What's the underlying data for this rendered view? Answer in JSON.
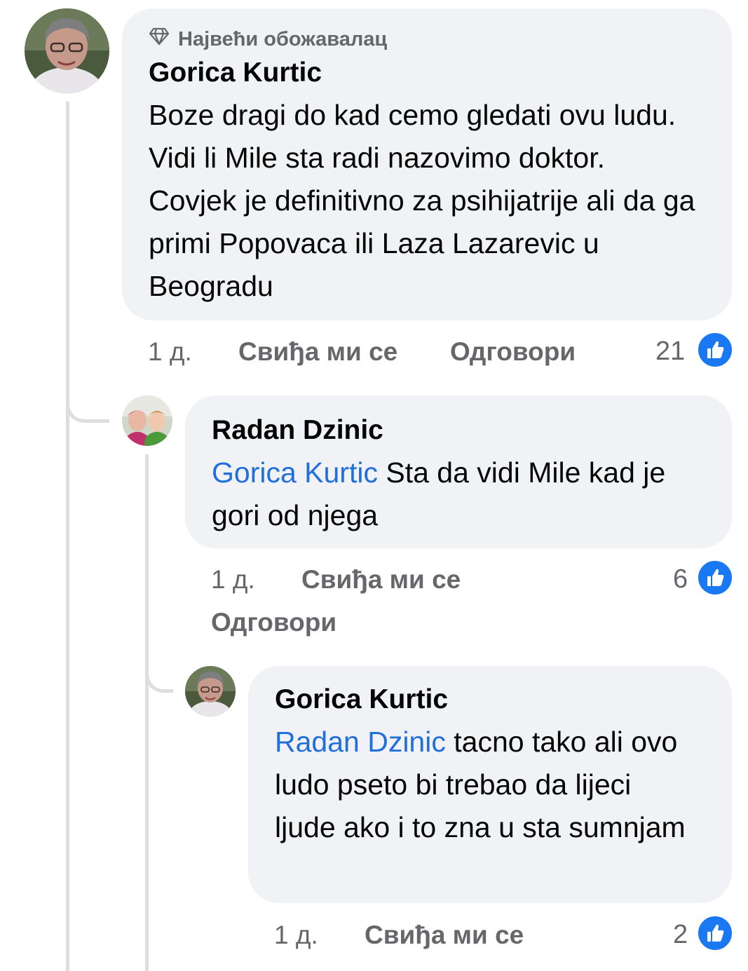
{
  "comments": [
    {
      "badge": "Највећи обожавалац",
      "author": "Gorica Kurtic",
      "text": "Boze dragi do kad cemo gledati ovu ludu. Vidi li Mile sta radi nazovimo doktor. Covjek je definitivno za psihijatrije ali da ga primi Popovaca ili Laza Lazarevic u Beogradu",
      "time": "1 д.",
      "like_label": "Свиђа ми се",
      "reply_label": "Одговори",
      "reactions": "21"
    },
    {
      "author": "Radan Dzinic",
      "mention": "Gorica Kurtic",
      "text": "Sta da vidi Mile kad je gori od njega",
      "time": "1 д.",
      "like_label": "Свиђа ми се",
      "reply_label": "Одговори",
      "reactions": "6"
    },
    {
      "author": "Gorica Kurtic",
      "mention": "Radan Dzinic",
      "text": "tacno tako ali ovo ludo pseto bi trebao da lijeci ljude ako i to zna u sta sumnjam",
      "time": "1 д.",
      "like_label": "Свиђа ми се",
      "reactions": "2"
    }
  ],
  "icons": {
    "badge": "diamond-icon",
    "reaction": "thumbs-up-icon"
  },
  "colors": {
    "bubble": "#f0f2f5",
    "mention": "#216fdb",
    "like_blue": "#1a78f2",
    "meta_grey": "#65676b"
  }
}
